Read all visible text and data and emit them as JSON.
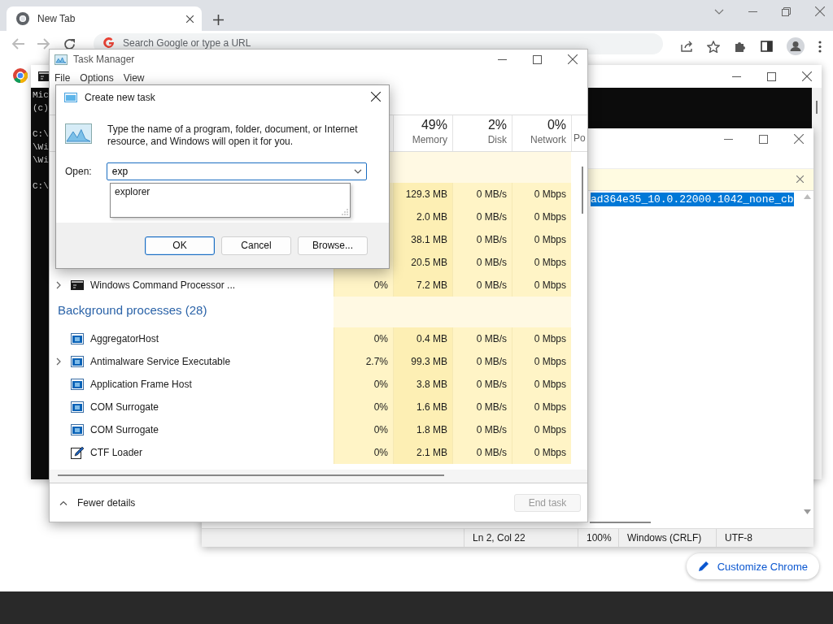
{
  "browser": {
    "tab": {
      "title": "New Tab"
    },
    "omnibox": {
      "placeholder": "Search Google or type a URL"
    },
    "customize_button": "Customize Chrome"
  },
  "console_window": {
    "blocks": [
      [
        "Mic",
        "(c)"
      ],
      [
        "C:\\",
        "\\Wi",
        "\\Wi"
      ],
      [
        "C:\\"
      ]
    ]
  },
  "notepad": {
    "lines": [
      {
        "text": "ad364e35_10.0.22000.1042_none_cb",
        "selected": true
      }
    ],
    "status_bar": [
      "Ln 2, Col 22",
      "100%",
      "Windows (CRLF)",
      "UTF-8"
    ]
  },
  "task_manager": {
    "title": "Task Manager",
    "menu": [
      "File",
      "Options",
      "View"
    ],
    "columns": [
      {
        "usage": "49%",
        "label": "Memory"
      },
      {
        "usage": "2%",
        "label": "Disk"
      },
      {
        "usage": "0%",
        "label": "Network"
      },
      {
        "label": "Po"
      }
    ],
    "groups": [
      {
        "rows": [
          {
            "memory": "129.3 MB",
            "disk": "0 MB/s",
            "network": "0 Mbps"
          },
          {
            "memory": "2.0 MB",
            "disk": "0 MB/s",
            "network": "0 Mbps"
          },
          {
            "memory": "38.1 MB",
            "disk": "0 MB/s",
            "network": "0 Mbps"
          },
          {
            "memory": "20.5 MB",
            "disk": "0 MB/s",
            "network": "0 Mbps"
          },
          {
            "name": "Windows Command Processor ...",
            "kind": "console",
            "expandable": true,
            "cpu": "0%",
            "memory": "7.2 MB",
            "disk": "0 MB/s",
            "network": "0 Mbps"
          }
        ]
      },
      {
        "title": "Background processes (28)",
        "rows": [
          {
            "name": "AggregatorHost",
            "kind": "service",
            "expandable": false,
            "cpu": "0%",
            "memory": "0.4 MB",
            "disk": "0 MB/s",
            "network": "0 Mbps"
          },
          {
            "name": "Antimalware Service Executable",
            "kind": "service",
            "expandable": true,
            "cpu": "2.7%",
            "memory": "99.3 MB",
            "disk": "0 MB/s",
            "network": "0 Mbps"
          },
          {
            "name": "Application Frame Host",
            "kind": "service",
            "expandable": false,
            "cpu": "0%",
            "memory": "3.8 MB",
            "disk": "0 MB/s",
            "network": "0 Mbps"
          },
          {
            "name": "COM Surrogate",
            "kind": "service",
            "expandable": false,
            "cpu": "0%",
            "memory": "1.6 MB",
            "disk": "0 MB/s",
            "network": "0 Mbps"
          },
          {
            "name": "COM Surrogate",
            "kind": "service",
            "expandable": false,
            "cpu": "0%",
            "memory": "1.8 MB",
            "disk": "0 MB/s",
            "network": "0 Mbps"
          },
          {
            "name": "CTF Loader",
            "kind": "pen",
            "expandable": false,
            "cpu": "0%",
            "memory": "2.1 MB",
            "disk": "0 MB/s",
            "network": "0 Mbps"
          }
        ]
      }
    ],
    "footer": {
      "toggle": "Fewer details",
      "end_task": {
        "label": "End task",
        "disabled": true
      }
    }
  },
  "dialog": {
    "title": "Create new task",
    "message": "Type the name of a program, folder, document, or Internet resource, and Windows will open it for you.",
    "open_label": "Open:",
    "value": "exp",
    "suggestions": [
      "explorer"
    ],
    "buttons": [
      {
        "label": "OK",
        "default": true
      },
      {
        "label": "Cancel",
        "default": false
      },
      {
        "label": "Browse...",
        "default": false
      }
    ]
  }
}
